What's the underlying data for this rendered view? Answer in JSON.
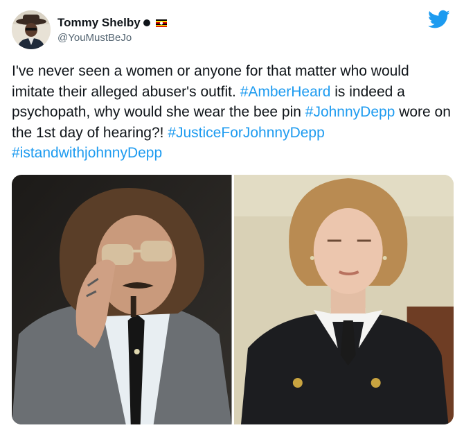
{
  "author": {
    "display_name": "Tommy Shelby",
    "handle": "@YouMustBeJo",
    "avatar_icon": "profile-avatar",
    "flag_icon": "uganda-flag-icon"
  },
  "platform": {
    "logo_icon": "twitter-bird-icon",
    "brand_color": "#1d9bf0"
  },
  "tweet": {
    "text_1": "I've never seen a women or anyone for that matter who would imitate their alleged abuser's outfit. ",
    "hashtag_1": "#AmberHeard",
    "text_2": " is indeed a psychopath, why would she wear the bee pin ",
    "hashtag_2": "#JohnnyDepp",
    "text_3": " wore on the 1st day of hearing?! ",
    "hashtag_3": "#JusticeForJohnnyDepp",
    "text_4": " ",
    "hashtag_4": "#istandwithjohnnyDepp"
  },
  "media": {
    "photos": [
      {
        "icon": "photo-man-in-sunglasses"
      },
      {
        "icon": "photo-woman-in-courtroom"
      }
    ]
  }
}
